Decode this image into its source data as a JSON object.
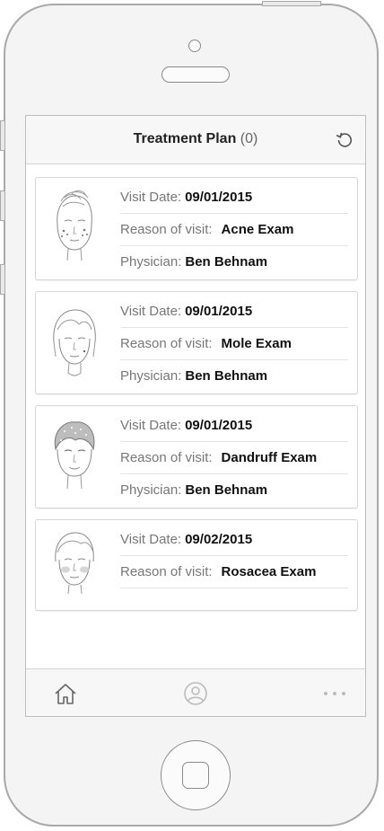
{
  "header": {
    "title": "Treatment Plan",
    "count": "(0)",
    "refresh_icon": "refresh-icon"
  },
  "visits": [
    {
      "face_icon": "face-acne-icon",
      "date_label": "Visit Date:",
      "date": "09/01/2015",
      "reason_label": "Reason of visit:",
      "reason": "Acne Exam",
      "physician_label": "Physician:",
      "physician": "Ben Behnam"
    },
    {
      "face_icon": "face-mole-icon",
      "date_label": "Visit Date:",
      "date": "09/01/2015",
      "reason_label": "Reason of visit:",
      "reason": "Mole Exam",
      "physician_label": "Physician:",
      "physician": "Ben Behnam"
    },
    {
      "face_icon": "face-dandruff-icon",
      "date_label": "Visit Date:",
      "date": "09/01/2015",
      "reason_label": "Reason of visit:",
      "reason": "Dandruff Exam",
      "physician_label": "Physician:",
      "physician": "Ben Behnam"
    },
    {
      "face_icon": "face-rosacea-icon",
      "date_label": "Visit Date:",
      "date": "09/02/2015",
      "reason_label": "Reason of visit:",
      "reason": "Rosacea Exam"
    }
  ],
  "tabbar": {
    "items": [
      "home-icon",
      "profile-icon",
      "more-icon"
    ]
  }
}
